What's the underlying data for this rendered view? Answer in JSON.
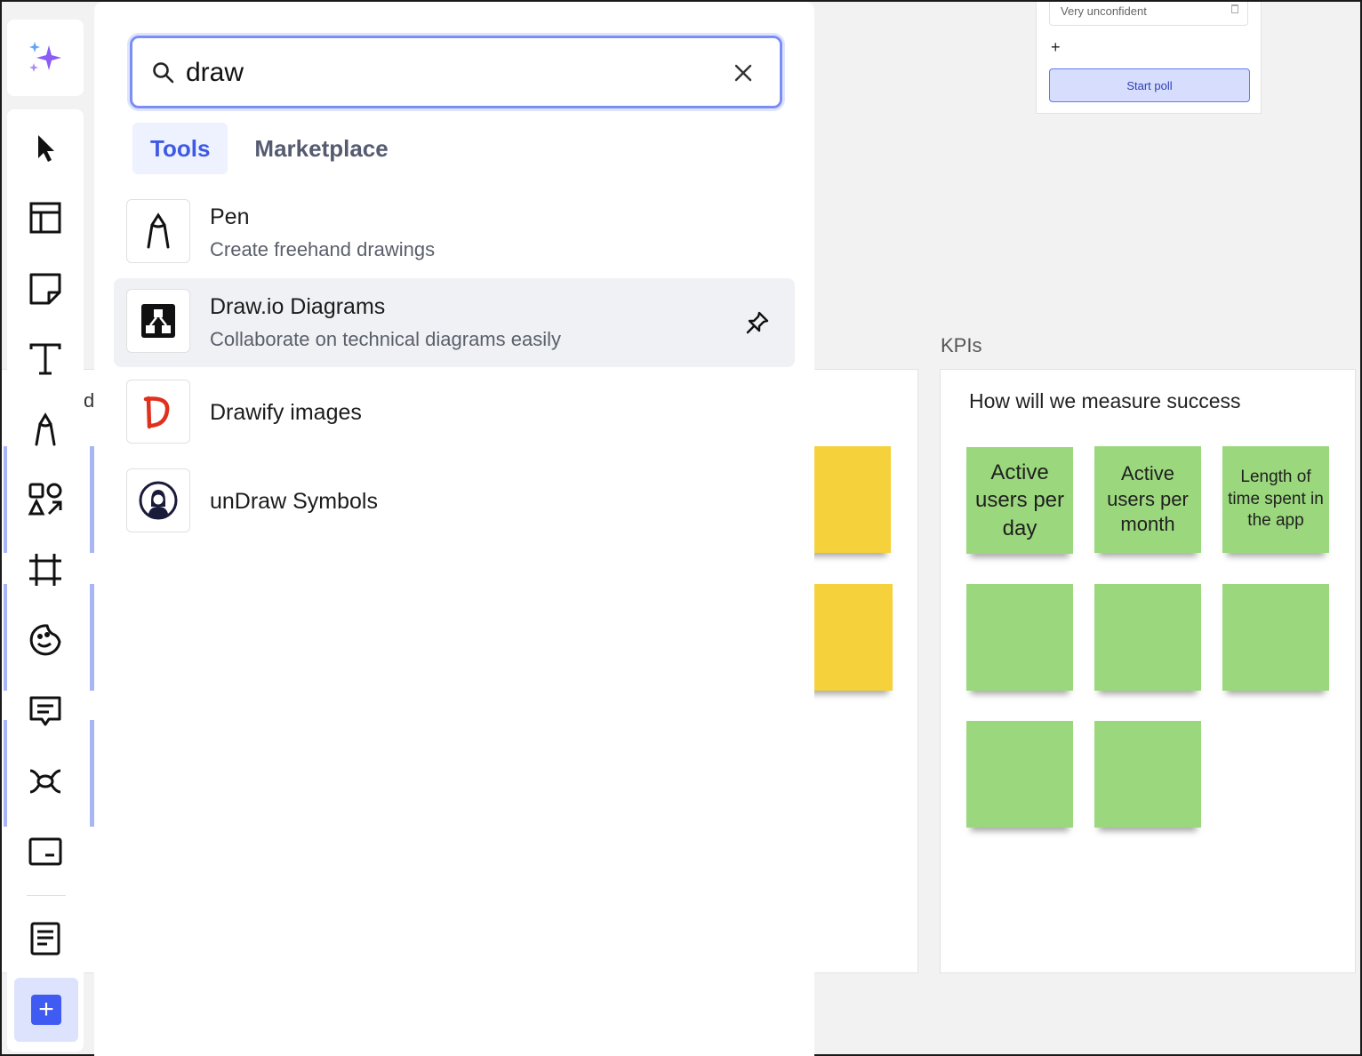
{
  "search": {
    "query": "draw",
    "placeholder": ""
  },
  "tabs": [
    {
      "label": "Tools",
      "active": true
    },
    {
      "label": "Marketplace",
      "active": false
    }
  ],
  "results": [
    {
      "title": "Pen",
      "subtitle": "Create freehand drawings",
      "icon": "pen-icon"
    },
    {
      "title": "Draw.io Diagrams",
      "subtitle": "Collaborate on technical diagrams easily",
      "icon": "drawio-icon",
      "pinnable": true
    },
    {
      "title": "Drawify images",
      "subtitle": "",
      "icon": "drawify-icon"
    },
    {
      "title": "unDraw Symbols",
      "subtitle": "",
      "icon": "undraw-icon"
    }
  ],
  "toolbar": {
    "tools": [
      "ai-sparkle-icon",
      "select-icon",
      "templates-icon",
      "sticky-note-icon",
      "text-icon",
      "pen-icon",
      "shapes-icon",
      "frame-icon",
      "sticker-icon",
      "comment-icon",
      "mind-map-icon",
      "card-icon",
      "document-icon",
      "add-icon"
    ]
  },
  "poll": {
    "option": "Very unconfident",
    "add": "+",
    "start_label": "Start poll"
  },
  "kpi": {
    "title": "KPIs",
    "heading": "How will we measure success",
    "stickies": [
      "Active users per day",
      "Active users per month",
      "Length of time spent in the app"
    ]
  },
  "canvas_fragment": "d",
  "colors": {
    "accent": "#3f5bf2",
    "sticky_green": "#9bd87d",
    "sticky_yellow": "#f5d13c"
  }
}
